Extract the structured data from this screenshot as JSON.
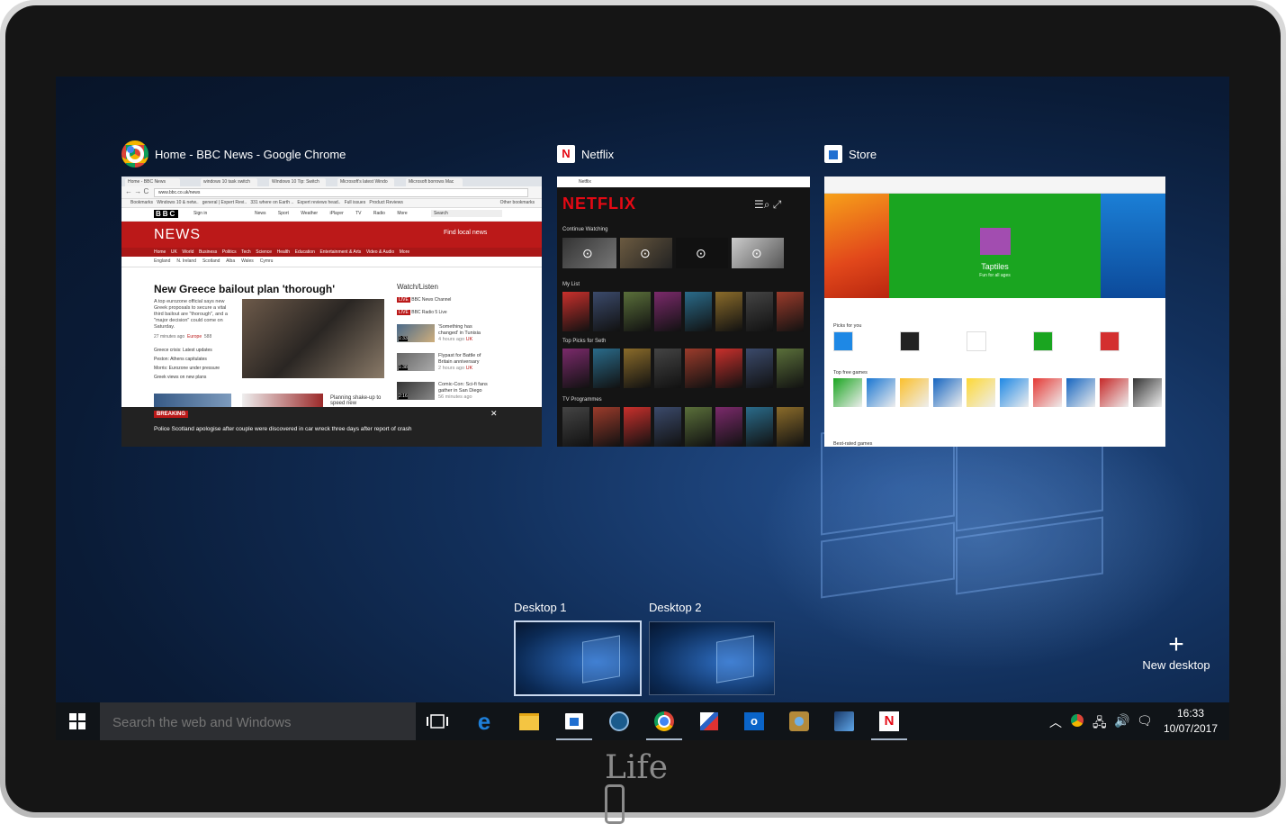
{
  "device": {
    "brand_logo": "Life"
  },
  "task_view": {
    "windows": [
      {
        "title": "Home - BBC News - Google Chrome",
        "icon": "chrome-icon"
      },
      {
        "title": "Netflix",
        "icon": "netflix-icon"
      },
      {
        "title": "Store",
        "icon": "store-icon"
      }
    ],
    "chrome_page": {
      "tabs": [
        "Home - BBC News",
        "windows 10 task switch",
        "Windows 10 Tip: Switch",
        "Microsoft's latest Windo",
        "Microsoft borrows Mac"
      ],
      "url": "www.bbc.co.uk/news",
      "bookmarks": [
        "Bookmarks",
        "Windows 10 & netw..",
        "general | Expert Revi..",
        "331 where on Earth ..",
        "Expert reviews head..",
        "Full issues",
        "Product Reviews"
      ],
      "other_bookmarks": "Other bookmarks",
      "bbc_logo": "BBC",
      "sign_in": "Sign in",
      "top_nav": [
        "News",
        "Sport",
        "Weather",
        "iPlayer",
        "TV",
        "Radio",
        "More"
      ],
      "search": "Search",
      "section": "NEWS",
      "find_local": "Find local news",
      "news_nav": [
        "Home",
        "UK",
        "World",
        "Business",
        "Politics",
        "Tech",
        "Science",
        "Health",
        "Education",
        "Entertainment & Arts",
        "Video & Audio",
        "More"
      ],
      "sub_nav": [
        "England",
        "N. Ireland",
        "Scotland",
        "Alba",
        "Wales",
        "Cymru"
      ],
      "headline": "New Greece bailout plan 'thorough'",
      "summary": "A top eurozone official says new Greek proposals to secure a vital third bailout are \"thorough\", and a \"major decision\" could come on Saturday.",
      "meta": "27 minutes ago",
      "meta_tag": "Europe",
      "meta_count": "588",
      "links": [
        "Greece crisis: Latest updates",
        "Peston: Athens capitulates",
        "Morris: Eurozone under pressure",
        "Greek views on new plans"
      ],
      "watch_title": "Watch/Listen",
      "live1": "BBC News Channel",
      "live2": "BBC Radio 5 Live",
      "videos": [
        {
          "title": "'Something has changed' in Tunisia",
          "time": "4 hours ago",
          "tag": "UK",
          "dur": "1:33"
        },
        {
          "title": "Flypast for Battle of Britain anniversary",
          "time": "2 hours ago",
          "tag": "UK",
          "dur": "1:38"
        },
        {
          "title": "Comic-Con: Sci-fi fans gather in San Diego",
          "time": "56 minutes ago",
          "tag": "",
          "dur": "2:16"
        }
      ],
      "planning": "Planning shake-up to speed new",
      "breaking_label": "BREAKING",
      "breaking_text": "Police Scotland apologise after couple were discovered in car wreck three days after report of crash"
    },
    "netflix_page": {
      "app": "Netflix",
      "logo": "NETFLIX",
      "rows": [
        "Continue Watching",
        "My List",
        "Top Picks for Seth",
        "TV Programmes"
      ]
    },
    "store_page": {
      "featured": "Taptiles",
      "featured_sub": "Fun for all ages",
      "picks": "Picks for you",
      "top_free": "Top free games",
      "best_rated": "Best-rated games"
    }
  },
  "desktops": [
    {
      "label": "Desktop 1",
      "active": true
    },
    {
      "label": "Desktop 2",
      "active": false
    }
  ],
  "new_desktop": "New desktop",
  "taskbar": {
    "search_placeholder": "Search the web and Windows",
    "time": "16:33",
    "date": "10/07/2017",
    "pinned": [
      "task-view-icon",
      "edge-icon",
      "file-explorer-icon",
      "store-icon",
      "steam-icon",
      "chrome-icon",
      "paint-icon",
      "outlook-icon",
      "hearthstone-icon",
      "game-icon",
      "netflix-icon"
    ]
  },
  "colors": {
    "bbc_red": "#bb1919",
    "netflix_red": "#e50914",
    "store_green": "#1aa520",
    "taskbar": "#101418"
  }
}
